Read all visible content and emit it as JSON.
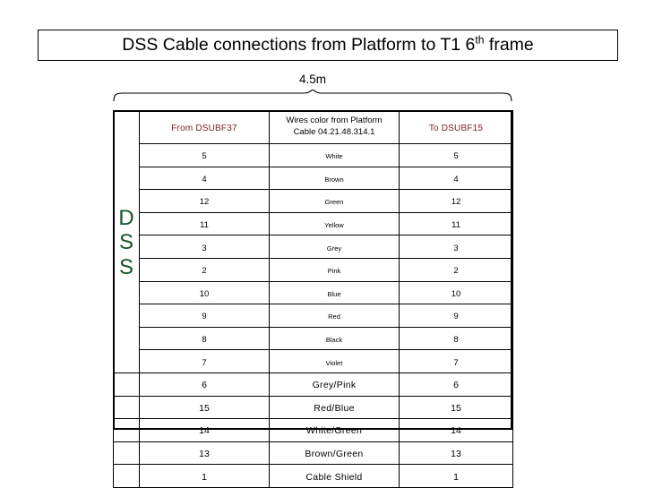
{
  "title": {
    "main": "DSS Cable connections from Platform to T1 6",
    "superscript": "th",
    "tail": " frame"
  },
  "dimension": {
    "label": "4.5m",
    "brace_icon": "curly-brace-horizontal"
  },
  "side_label": {
    "letters": [
      "D",
      "S",
      "S"
    ],
    "color": "#12562a"
  },
  "table": {
    "headers": {
      "dss": "",
      "from": "From DSUBF37",
      "wires_line1": "Wires color from Platform",
      "wires_line2": "Cable 04.21.48.314.1",
      "to": "To DSUBF15"
    },
    "header_color_from_to": "#7d2020",
    "header_color_wires": "#000000",
    "rows": [
      {
        "from": "5",
        "wire": "White",
        "to": "5",
        "style": "small"
      },
      {
        "from": "4",
        "wire": "Brown",
        "to": "4",
        "style": "small"
      },
      {
        "from": "12",
        "wire": "Green",
        "to": "12",
        "style": "small"
      },
      {
        "from": "11",
        "wire": "Yellow",
        "to": "11",
        "style": "small"
      },
      {
        "from": "3",
        "wire": "Grey",
        "to": "3",
        "style": "small"
      },
      {
        "from": "2",
        "wire": "Pink",
        "to": "2",
        "style": "small"
      },
      {
        "from": "10",
        "wire": "Blue",
        "to": "10",
        "style": "small"
      },
      {
        "from": "9",
        "wire": "Red",
        "to": "9",
        "style": "small"
      },
      {
        "from": "8",
        "wire": "Black",
        "to": "8",
        "style": "small"
      },
      {
        "from": "7",
        "wire": "Violet",
        "to": "7",
        "style": "small"
      },
      {
        "from": "6",
        "wire": "Grey/Pink",
        "to": "6",
        "style": "large"
      },
      {
        "from": "15",
        "wire": "Red/Blue",
        "to": "15",
        "style": "large"
      },
      {
        "from": "14",
        "wire": "White/Green",
        "to": "14",
        "style": "large"
      },
      {
        "from": "13",
        "wire": "Brown/Green",
        "to": "13",
        "style": "large"
      },
      {
        "from": "1",
        "wire": "Cable Shield",
        "to": "1",
        "style": "large"
      }
    ]
  }
}
